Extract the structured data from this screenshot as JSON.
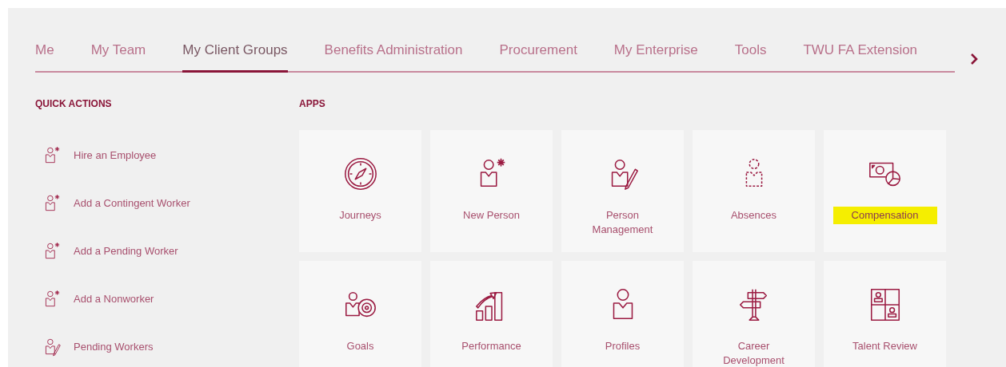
{
  "tabs": [
    {
      "label": "Me",
      "selected": false
    },
    {
      "label": "My Team",
      "selected": false
    },
    {
      "label": "My Client Groups",
      "selected": true
    },
    {
      "label": "Benefits Administration",
      "selected": false
    },
    {
      "label": "Procurement",
      "selected": false
    },
    {
      "label": "My Enterprise",
      "selected": false
    },
    {
      "label": "Tools",
      "selected": false
    },
    {
      "label": "TWU FA Extension",
      "selected": false
    }
  ],
  "quick_actions": {
    "heading": "QUICK ACTIONS",
    "items": [
      {
        "label": "Hire an Employee",
        "kind": "add"
      },
      {
        "label": "Add a Contingent Worker",
        "kind": "add"
      },
      {
        "label": "Add a Pending Worker",
        "kind": "add"
      },
      {
        "label": "Add a Nonworker",
        "kind": "add"
      },
      {
        "label": "Pending Workers",
        "kind": "edit"
      }
    ]
  },
  "apps": {
    "heading": "APPS",
    "items": [
      {
        "label": "Journeys",
        "highlighted": false
      },
      {
        "label": "New Person",
        "highlighted": false
      },
      {
        "label": "Person Management",
        "highlighted": false
      },
      {
        "label": "Absences",
        "highlighted": false
      },
      {
        "label": "Compensation",
        "highlighted": true
      },
      {
        "label": "Goals",
        "highlighted": false
      },
      {
        "label": "Performance",
        "highlighted": false
      },
      {
        "label": "Profiles",
        "highlighted": false
      },
      {
        "label": "Career Development",
        "highlighted": false
      },
      {
        "label": "Talent Review",
        "highlighted": false
      }
    ]
  }
}
